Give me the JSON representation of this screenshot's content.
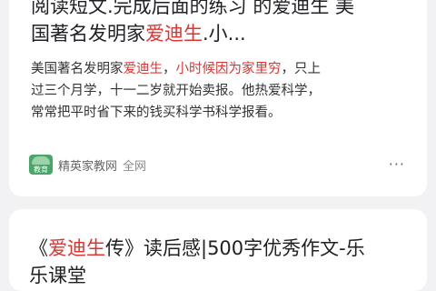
{
  "result1": {
    "title_line1": "阅读短文.完成后面的练习 的爱迪生 美",
    "title_line2_pre": "国著名发明家",
    "title_line2_highlight": "爱迪生",
    "title_line2_post": ".小...",
    "snippet_line1_pre": "美国著名发明家",
    "snippet_line1_hl1": "爱迪生",
    "snippet_line1_mid": "，",
    "snippet_line1_hl2": "小时候因为家里穷",
    "snippet_line1_post": "，只上",
    "snippet_line2": "过三个月学，十一二岁就开始卖报。他热爱科学，",
    "snippet_line3": "常常把平时省下来的钱买科学书科学报看。",
    "source_logo_text": "教育",
    "source_name": "精英家教网",
    "source_scope": "全网",
    "more_label": "···"
  },
  "result2": {
    "title_pre": "《",
    "title_highlight": "爱迪生",
    "title_post": "传》读后感|500字优秀作文-乐",
    "title_line2": "乐课堂"
  },
  "colors": {
    "highlight": "#e0332f",
    "background": "#f2f2f4",
    "card": "#ffffff"
  }
}
